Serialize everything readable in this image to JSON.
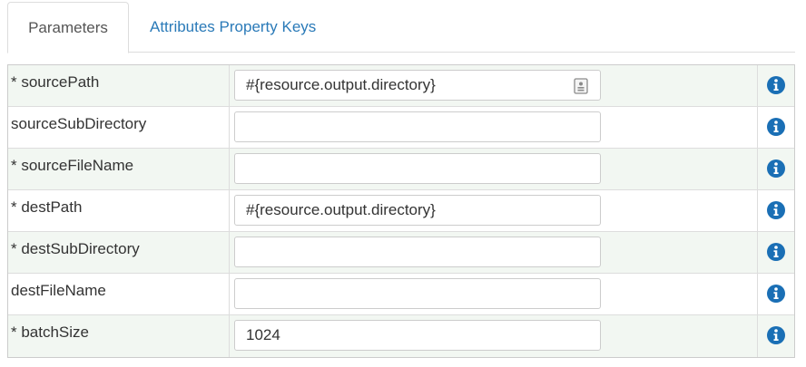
{
  "tabs": [
    {
      "label": "Parameters",
      "active": true
    },
    {
      "label": "Attributes Property Keys",
      "active": false
    }
  ],
  "colors": {
    "link": "#2a7ab8",
    "info_icon": "#1a6fb5",
    "row_alt": "#f2f7f2",
    "border": "#dddddd"
  },
  "params": [
    {
      "label": "* sourcePath",
      "value": "#{resource.output.directory}",
      "placeholder": "",
      "has_field_icon": true,
      "info_icon": "info-icon"
    },
    {
      "label": "sourceSubDirectory",
      "value": "",
      "placeholder": "",
      "has_field_icon": false,
      "info_icon": "info-icon"
    },
    {
      "label": "* sourceFileName",
      "value": "",
      "placeholder": "",
      "has_field_icon": false,
      "info_icon": "info-icon"
    },
    {
      "label": "* destPath",
      "value": "#{resource.output.directory}",
      "placeholder": "",
      "has_field_icon": false,
      "info_icon": "info-icon"
    },
    {
      "label": "* destSubDirectory",
      "value": "",
      "placeholder": "",
      "has_field_icon": false,
      "info_icon": "info-icon"
    },
    {
      "label": "destFileName",
      "value": "",
      "placeholder": "",
      "has_field_icon": false,
      "info_icon": "info-icon"
    },
    {
      "label": "* batchSize",
      "value": "1024",
      "placeholder": "",
      "has_field_icon": false,
      "info_icon": "info-icon"
    }
  ]
}
